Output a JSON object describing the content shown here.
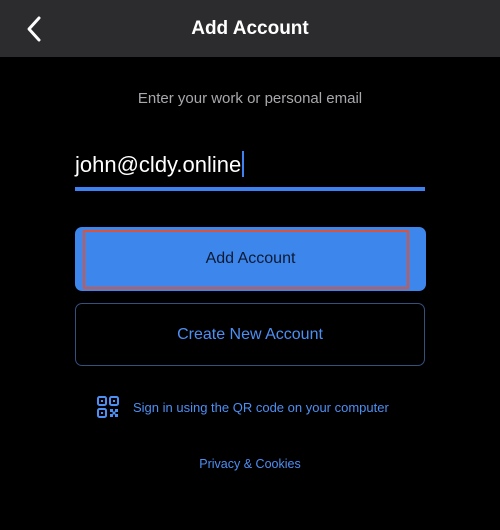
{
  "nav": {
    "title": "Add Account",
    "back_icon": "chevron-left-icon"
  },
  "form": {
    "prompt": "Enter your work or personal email",
    "email_value": "john@cldy.online"
  },
  "buttons": {
    "add_account": "Add Account",
    "create_account": "Create New Account"
  },
  "qr": {
    "icon": "qr-code-icon",
    "label": "Sign in using the QR code on your computer"
  },
  "footer": {
    "privacy": "Privacy & Cookies"
  },
  "colors": {
    "background": "#000000",
    "nav_bar": "#2c2c2e",
    "accent": "#3d86ec",
    "link": "#4d8ff2",
    "focus_ring": "#d9543c"
  }
}
